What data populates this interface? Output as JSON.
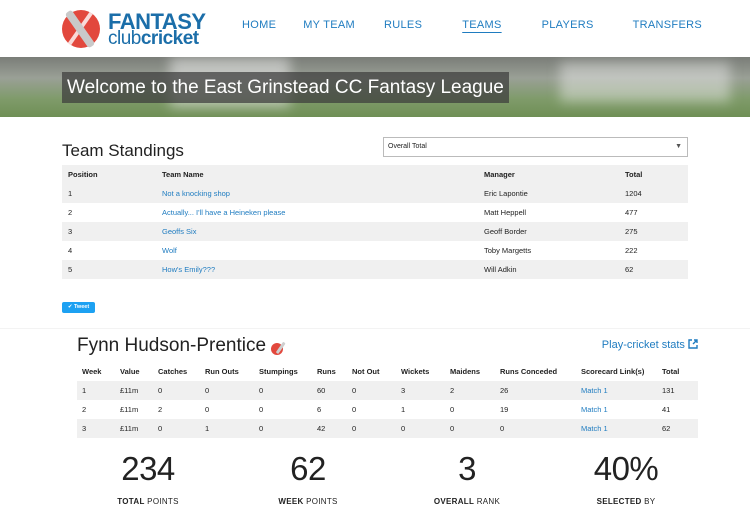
{
  "header": {
    "logo": {
      "line1": "FANTASY",
      "line2_a": "club",
      "line2_b": "cricket"
    },
    "nav": [
      {
        "label": "HOME"
      },
      {
        "label": "MY TEAM"
      },
      {
        "label": "RULES"
      },
      {
        "label": "TEAMS",
        "active": true
      },
      {
        "label": "PLAYERS"
      },
      {
        "label": "TRANSFERS"
      }
    ]
  },
  "banner": {
    "title": "Welcome to the East Grinstead CC Fantasy League"
  },
  "standings": {
    "title": "Team Standings",
    "select_value": "Overall Total",
    "columns": [
      "Position",
      "Team Name",
      "Manager",
      "Total"
    ],
    "rows": [
      {
        "position": "1",
        "team": "Not a knocking shop",
        "manager": "Eric Lapontie",
        "total": "1204"
      },
      {
        "position": "2",
        "team": "Actually... I'll have a Heineken please",
        "manager": "Matt Heppell",
        "total": "477"
      },
      {
        "position": "3",
        "team": "Geoffs Six",
        "manager": "Geoff Border",
        "total": "275"
      },
      {
        "position": "4",
        "team": "Wolf",
        "manager": "Toby Margetts",
        "total": "222"
      },
      {
        "position": "5",
        "team": "How's Emily???",
        "manager": "Will Adkin",
        "total": "62"
      }
    ],
    "tweet_label": "Tweet"
  },
  "player": {
    "name": "Fynn Hudson-Prentice",
    "stats_link": "Play-cricket stats",
    "columns": [
      "Week",
      "Value",
      "Catches",
      "Run Outs",
      "Stumpings",
      "Runs",
      "Not Out",
      "Wickets",
      "Maidens",
      "Runs Conceded",
      "Scorecard Link(s)",
      "Total"
    ],
    "rows": [
      [
        "1",
        "£11m",
        "0",
        "0",
        "0",
        "60",
        "0",
        "3",
        "2",
        "26",
        "Match 1",
        "131"
      ],
      [
        "2",
        "£11m",
        "2",
        "0",
        "0",
        "6",
        "0",
        "1",
        "0",
        "19",
        "Match 1",
        "41"
      ],
      [
        "3",
        "£11m",
        "0",
        "1",
        "0",
        "42",
        "0",
        "0",
        "0",
        "0",
        "Match 1",
        "62"
      ]
    ],
    "summary": [
      {
        "value": "234",
        "label_bold": "TOTAL",
        "label_rest": " POINTS"
      },
      {
        "value": "62",
        "label_bold": "WEEK",
        "label_rest": " POINTS"
      },
      {
        "value": "3",
        "label_bold": "OVERALL",
        "label_rest": " RANK"
      },
      {
        "value": "40%",
        "label_bold": "SELECTED",
        "label_rest": " BY"
      }
    ]
  },
  "colors": {
    "link": "#1f7cc0",
    "logo_red": "#e2483d",
    "twitter": "#1da1f2"
  }
}
